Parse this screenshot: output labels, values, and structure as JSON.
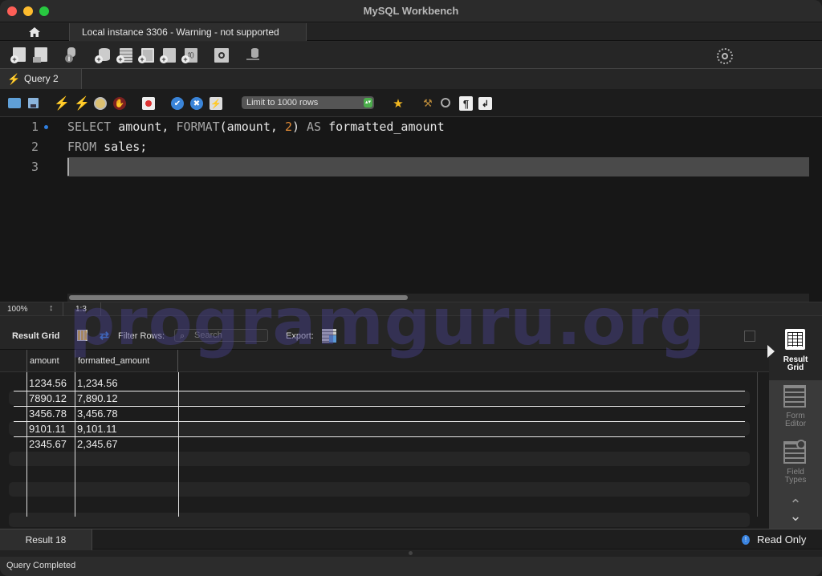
{
  "window": {
    "title": "MySQL Workbench"
  },
  "tabs": {
    "home_icon": "home-icon",
    "connection_tab": "Local instance 3306 - Warning - not supported"
  },
  "main_toolbar": {
    "icons": [
      "new-sql-tab-icon",
      "open-sql-script-icon",
      "schema-inspector-icon",
      "create-schema-icon",
      "create-table-icon",
      "create-view-icon",
      "create-procedure-icon",
      "create-function-icon",
      "search-table-data-icon",
      "reconnect-icon"
    ],
    "right_icons": [
      "preferences-icon",
      "toggle-sidebar-icon",
      "toggle-output-icon",
      "toggle-secondary-sidebar-icon"
    ]
  },
  "query_tab": {
    "label": "Query 2"
  },
  "sql_toolbar": {
    "icons": [
      "open-file-icon",
      "save-icon",
      "execute-icon",
      "execute-current-icon",
      "explain-icon",
      "stop-icon",
      "toggle-error-icon",
      "commit-icon",
      "rollback-icon",
      "autocommit-icon"
    ],
    "limit_select": "Limit to 1000 rows",
    "right_icons": [
      "add-snippet-icon",
      "beautify-icon",
      "find-icon",
      "invisible-chars-icon",
      "word-wrap-icon"
    ]
  },
  "editor": {
    "line_numbers": [
      "1",
      "2",
      "3"
    ],
    "lines": [
      [
        {
          "t": "SELECT",
          "c": "kw"
        },
        {
          "t": " amount, ",
          "c": ""
        },
        {
          "t": "FORMAT",
          "c": "kw"
        },
        {
          "t": "(amount, ",
          "c": ""
        },
        {
          "t": "2",
          "c": "num"
        },
        {
          "t": ") ",
          "c": ""
        },
        {
          "t": "AS",
          "c": "kw"
        },
        {
          "t": " formatted_amount",
          "c": ""
        }
      ],
      [
        {
          "t": "FROM",
          "c": "kw"
        },
        {
          "t": " sales;",
          "c": ""
        }
      ],
      []
    ],
    "zoom": "100%",
    "cursor_position": "1:3"
  },
  "result_toolbar": {
    "result_grid_label": "Result Grid",
    "filter_label": "Filter Rows:",
    "search_placeholder": "Search",
    "export_label": "Export:"
  },
  "grid": {
    "columns": [
      "amount",
      "formatted_amount"
    ],
    "rows": [
      [
        "1234.56",
        "1,234.56"
      ],
      [
        "7890.12",
        "7,890.12"
      ],
      [
        "3456.78",
        "3,456.78"
      ],
      [
        "9101.11",
        "9,101.11"
      ],
      [
        "2345.67",
        "2,345.67"
      ]
    ]
  },
  "side_panel": {
    "items": [
      {
        "label1": "Result",
        "label2": "Grid",
        "active": true
      },
      {
        "label1": "Form",
        "label2": "Editor",
        "active": false
      },
      {
        "label1": "Field",
        "label2": "Types",
        "active": false
      }
    ]
  },
  "bottom": {
    "result_tab": "Result 18",
    "read_only": "Read Only",
    "status": "Query Completed"
  },
  "watermark": "programguru.org"
}
